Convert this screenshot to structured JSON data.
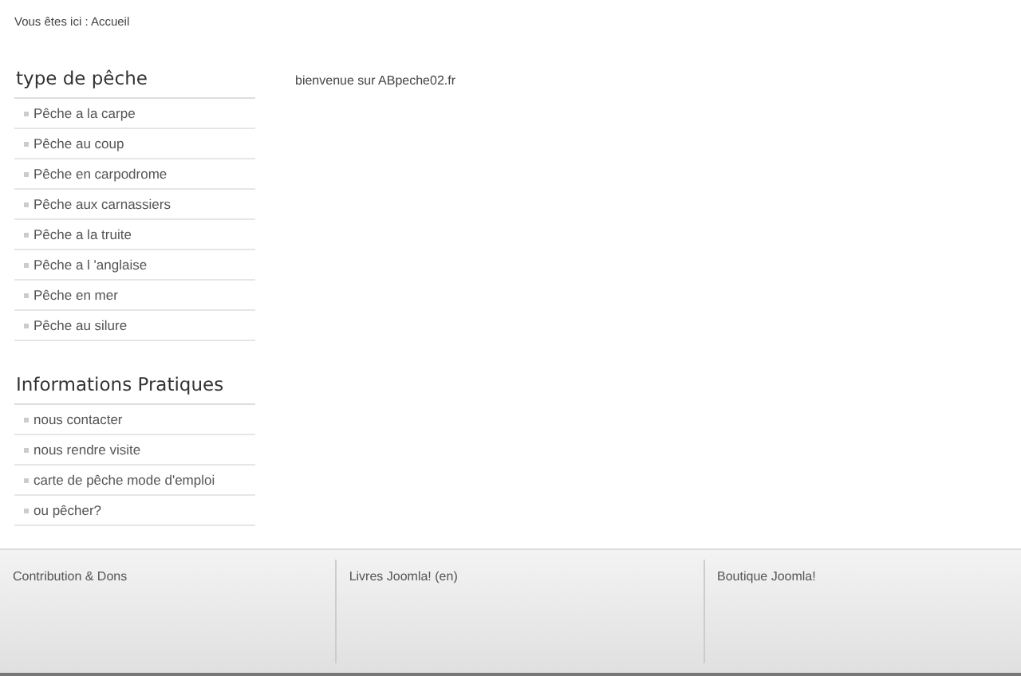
{
  "breadcrumb": "Vous êtes ici : Accueil",
  "sidebar": [
    {
      "title": "type de pêche",
      "items": [
        "Pêche a la carpe",
        "Pêche au coup",
        "Pêche en carpodrome",
        "Pêche aux carnassiers",
        "Pêche a la truite",
        "Pêche a l 'anglaise",
        "Pêche en mer",
        "Pêche au silure"
      ]
    },
    {
      "title": "Informations Pratiques",
      "items": [
        "nous contacter",
        "nous rendre visite",
        "carte de pêche mode d'emploi",
        "ou pêcher?"
      ]
    }
  ],
  "content": "bienvenue sur ABpeche02.fr",
  "footer": [
    "Contribution & Dons",
    "Livres Joomla! (en)",
    "Boutique Joomla!"
  ]
}
